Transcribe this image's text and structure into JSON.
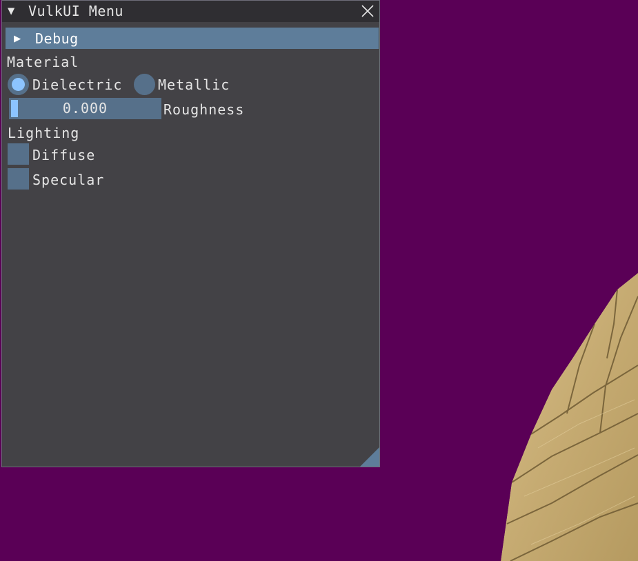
{
  "window": {
    "title": "VulkUI Menu",
    "collapse_glyph": "▼",
    "close_icon": "close-icon"
  },
  "debug_header": {
    "label": "Debug",
    "glyph": "▶",
    "expanded": false
  },
  "material": {
    "label": "Material",
    "options": [
      {
        "label": "Dielectric",
        "selected": true
      },
      {
        "label": "Metallic",
        "selected": false
      }
    ],
    "roughness": {
      "label": "Roughness",
      "value": "0.000",
      "fraction": 0.0
    }
  },
  "lighting": {
    "label": "Lighting",
    "options": [
      {
        "label": "Diffuse",
        "checked": false
      },
      {
        "label": "Specular",
        "checked": false
      }
    ]
  },
  "colors": {
    "background": "#5a0056",
    "window_bg": "#434246",
    "widget": "#56708a",
    "accent": "#8cc4ff",
    "header": "#5e7d9a",
    "wood": "#c8ad72"
  }
}
